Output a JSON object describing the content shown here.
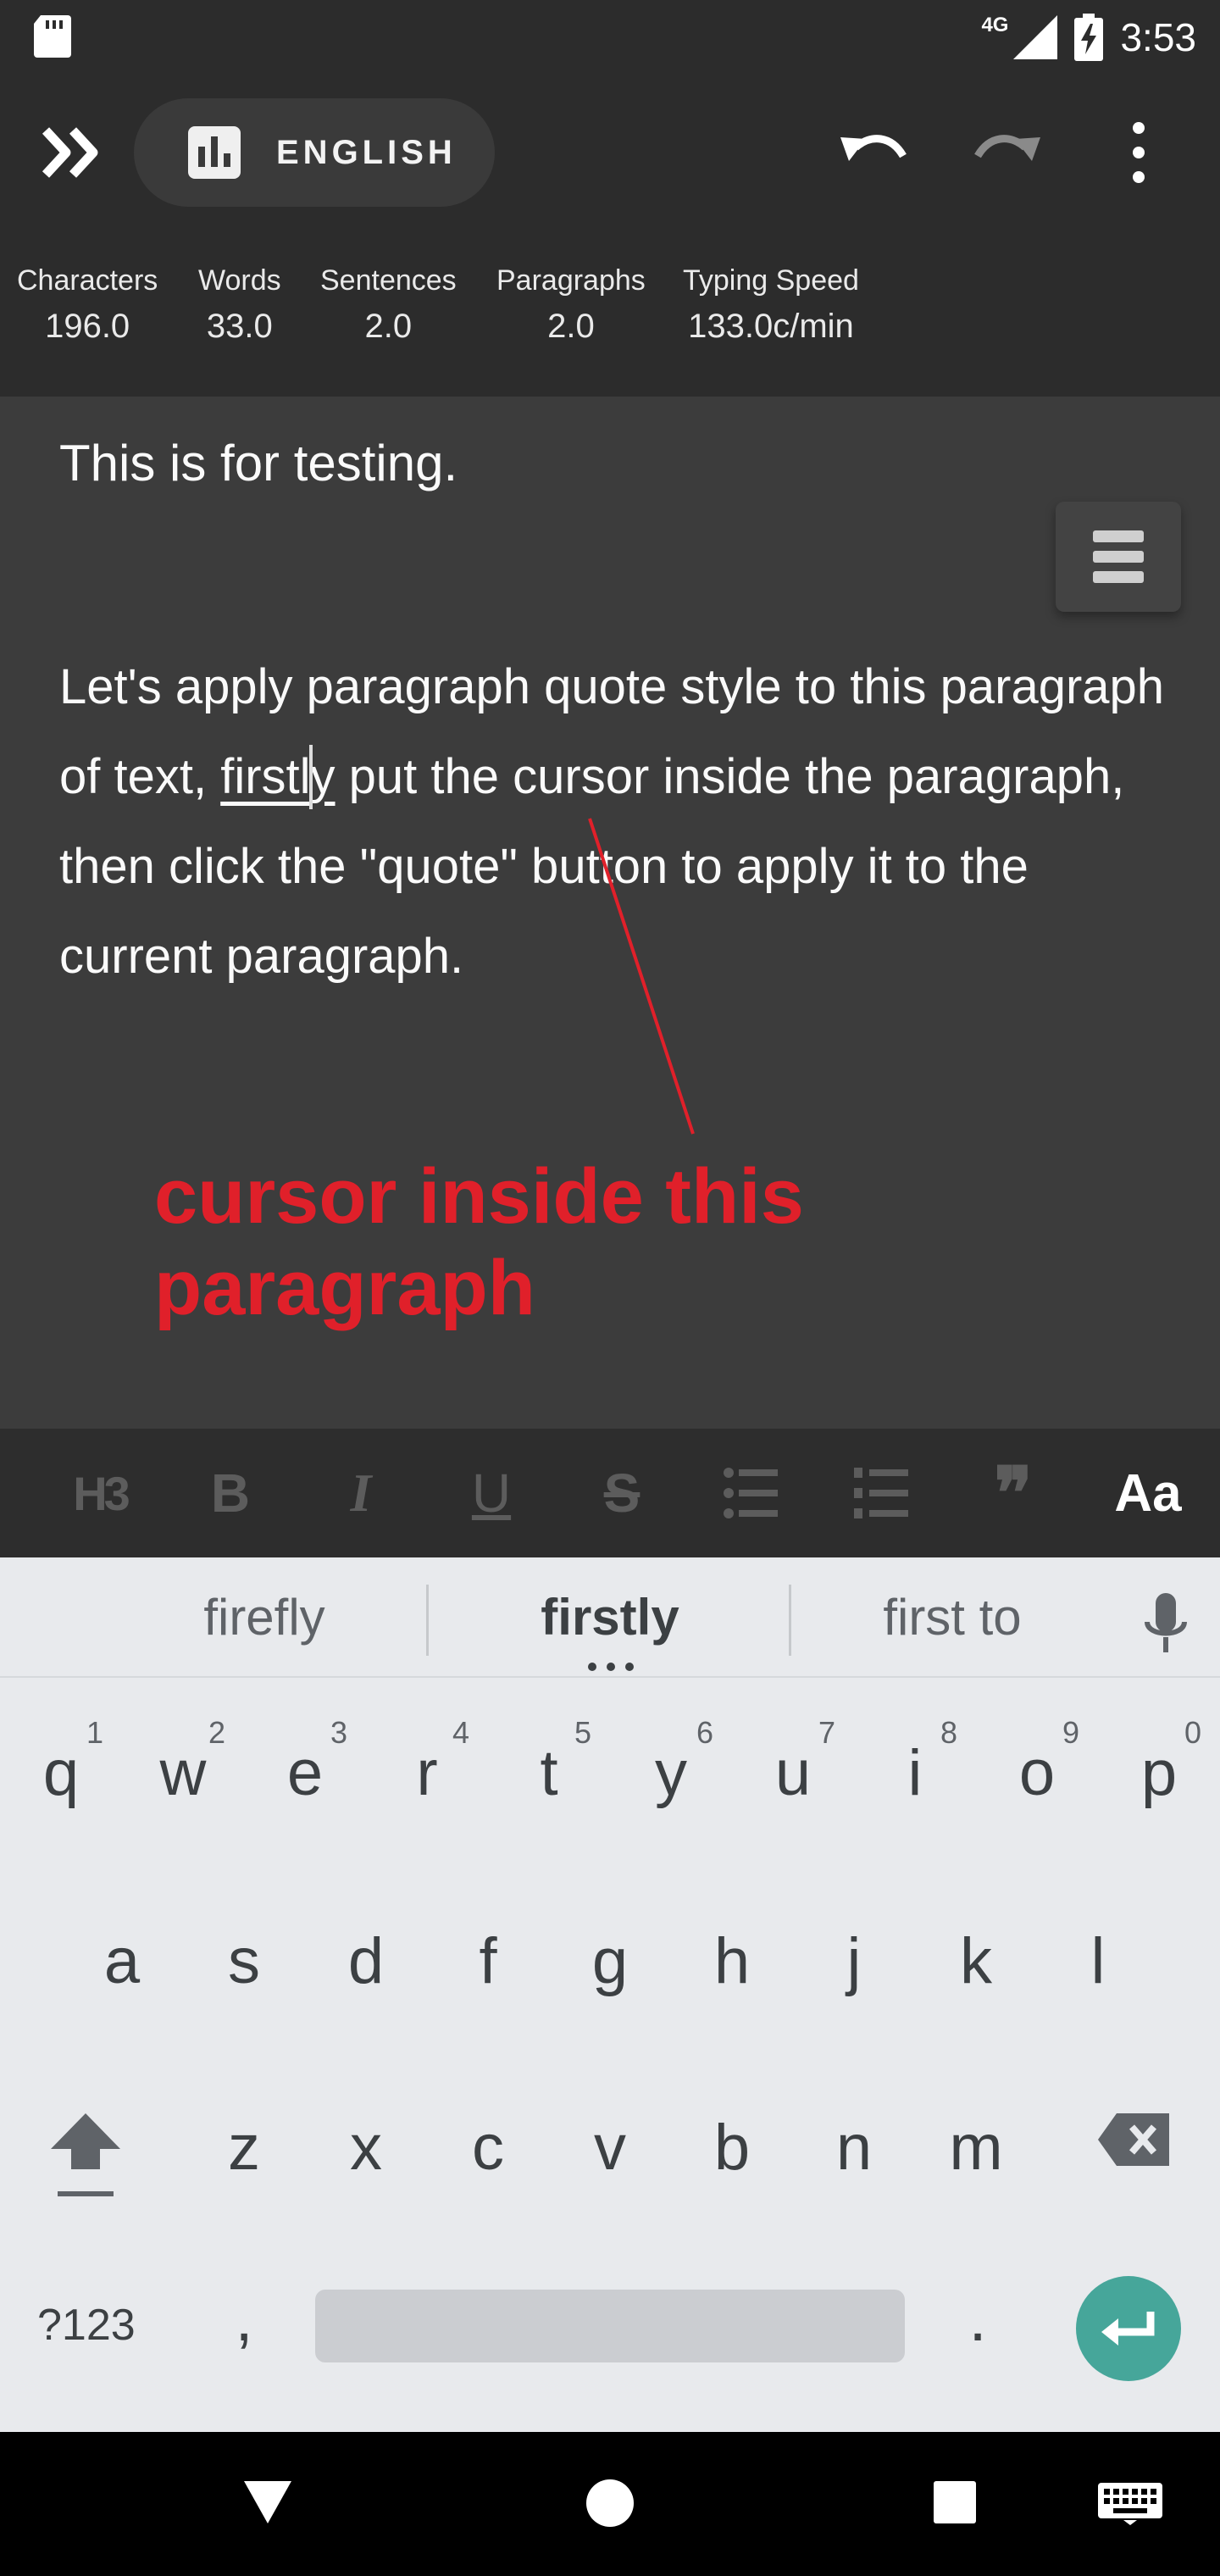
{
  "status_bar": {
    "network": "4G",
    "time": "3:53",
    "icons": [
      "sd-card-icon",
      "signal-icon",
      "battery-charging-icon"
    ]
  },
  "app_bar": {
    "language": "ENGLISH",
    "icons": [
      "double-chevron-right-icon",
      "bar-chart-icon",
      "undo-icon",
      "redo-icon",
      "more-vert-icon"
    ]
  },
  "stats": [
    {
      "label": "Characters",
      "value": "196.0"
    },
    {
      "label": "Words",
      "value": "33.0"
    },
    {
      "label": "Sentences",
      "value": "2.0"
    },
    {
      "label": "Paragraphs",
      "value": "2.0"
    },
    {
      "label": "Typing Speed",
      "value": "133.0c/min"
    }
  ],
  "editor": {
    "paragraph1": "This is for testing.",
    "paragraph2_before": "Let's apply paragraph quote style to this paragraph of text, ",
    "word_before_caret": "firstl",
    "word_after_caret": "y",
    "paragraph2_after": " put the cursor inside the paragraph, then click the \"quote\" button to apply it to the current paragraph.",
    "annotation": "cursor inside this paragraph",
    "annotation_color": "#e0202a"
  },
  "format_toolbar": {
    "heading": "H3",
    "bold": "B",
    "italic": "I",
    "underline": "U",
    "strike": "S",
    "quote": "❞",
    "text_size": "Aa"
  },
  "suggestions": {
    "left": "firefly",
    "center": "firstly",
    "right": "first to"
  },
  "keyboard": {
    "row1": [
      {
        "letter": "q",
        "num": "1"
      },
      {
        "letter": "w",
        "num": "2"
      },
      {
        "letter": "e",
        "num": "3"
      },
      {
        "letter": "r",
        "num": "4"
      },
      {
        "letter": "t",
        "num": "5"
      },
      {
        "letter": "y",
        "num": "6"
      },
      {
        "letter": "u",
        "num": "7"
      },
      {
        "letter": "i",
        "num": "8"
      },
      {
        "letter": "o",
        "num": "9"
      },
      {
        "letter": "p",
        "num": "0"
      }
    ],
    "row2": [
      "a",
      "s",
      "d",
      "f",
      "g",
      "h",
      "j",
      "k",
      "l"
    ],
    "row3": [
      "z",
      "x",
      "c",
      "v",
      "b",
      "n",
      "m"
    ],
    "symbols": "?123",
    "comma": ",",
    "period": ".",
    "accent": "#46a69a"
  }
}
